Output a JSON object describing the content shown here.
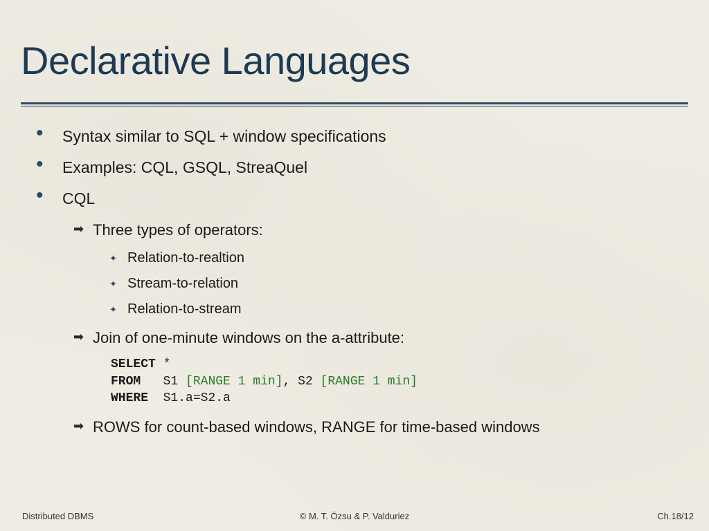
{
  "title": "Declarative Languages",
  "bullets": [
    {
      "text": "Syntax similar to SQL + window specifications"
    },
    {
      "text": "Examples: CQL, GSQL, StreaQuel"
    },
    {
      "text": "CQL"
    }
  ],
  "arrows": {
    "operators": "Three types of operators:",
    "join": "Join of one-minute windows on the a-attribute:",
    "rows_range": "ROWS for count-based windows, RANGE for time-based windows"
  },
  "operator_types": [
    "Relation-to-realtion",
    "Stream-to-relation",
    "Relation-to-stream"
  ],
  "code": {
    "kw_select": "SELECT",
    "select_rest": " *",
    "kw_from": "FROM",
    "from_gap": "   S1 ",
    "range1_open": "[",
    "range1_kw": "RANGE 1 min",
    "range1_close": "]",
    "between": ", S2 ",
    "range2_open": "[",
    "range2_kw": "RANGE 1 min",
    "range2_close": "]",
    "kw_where": "WHERE",
    "where_rest": "  S1.a=S2.a"
  },
  "footer": {
    "left": "Distributed DBMS",
    "center": "© M. T. Özsu & P. Valduriez",
    "right": "Ch.18/12"
  }
}
